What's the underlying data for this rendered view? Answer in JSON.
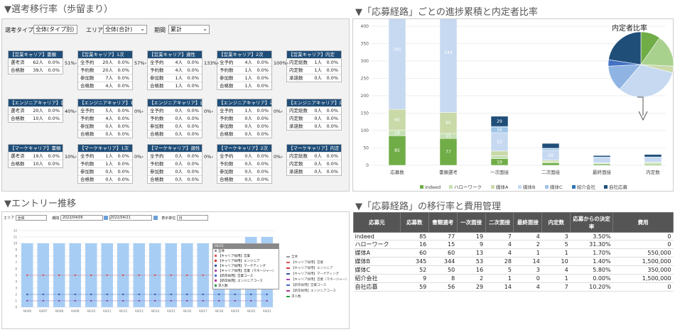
{
  "sections": {
    "funnel": "▼選考移行率（歩留まり）",
    "stack": "▼「応募経路」ごとの進捗累積と内定者比率",
    "entry": "▼エントリー推移",
    "cost": "▼「応募経路」の移行率と費用管理"
  },
  "filters": {
    "type_label": "選考タイプ",
    "type_value": "全体(タイプ別)",
    "area_label": "エリア",
    "area_value": "全体(合計)",
    "period_label": "期間",
    "period_value": "累計"
  },
  "funnel": {
    "rows": [
      {
        "cards": [
          {
            "title": "【営業キャリア】書類",
            "items": [
              {
                "l": "選考済",
                "v": "62",
                "u": "人",
                "p": "0.0%"
              },
              {
                "l": "合格数",
                "v": "39",
                "u": "人",
                "p": "0.0%"
              }
            ]
          },
          {
            "title": "【営業キャリア】1次",
            "items": [
              {
                "l": "全予約",
                "v": "20",
                "u": "人",
                "p": "0.0%"
              },
              {
                "l": "予約数",
                "v": "20",
                "u": "人",
                "p": "0.0%"
              },
              {
                "l": "参加数",
                "v": "7",
                "u": "人",
                "p": "0.0%"
              },
              {
                "l": "合格数",
                "v": "4",
                "u": "人",
                "p": "0.0%"
              }
            ]
          },
          {
            "title": "【営業キャリア】適性",
            "items": [
              {
                "l": "全予約",
                "v": "4",
                "u": "人",
                "p": "0.0%"
              },
              {
                "l": "予約数",
                "v": "4",
                "u": "人",
                "p": "0.0%"
              },
              {
                "l": "参加数",
                "v": "1",
                "u": "人",
                "p": "0.0%"
              },
              {
                "l": "合格数",
                "v": "1",
                "u": "人",
                "p": "0.0%"
              }
            ]
          },
          {
            "title": "【営業キャリア】2次",
            "items": [
              {
                "l": "全予約",
                "v": "4",
                "u": "人",
                "p": "0.0%"
              },
              {
                "l": "予約数",
                "v": "1",
                "u": "人",
                "p": "0.0%"
              },
              {
                "l": "参加数",
                "v": "1",
                "u": "人",
                "p": "0.0%"
              },
              {
                "l": "合格数",
                "v": "1",
                "u": "人",
                "p": "0.0%"
              }
            ]
          },
          {
            "title": "【営業キャリア】内定",
            "items": [
              {
                "l": "内定総数",
                "v": "1",
                "u": "人",
                "p": "0.0%"
              },
              {
                "l": "内定数",
                "v": "1",
                "u": "人",
                "p": "0.0%"
              },
              {
                "l": "承諾数",
                "v": "0",
                "u": "人",
                "p": "0.0%"
              }
            ]
          }
        ],
        "rates": [
          "51%",
          "57%",
          "133%",
          "100%"
        ]
      },
      {
        "cards": [
          {
            "title": "【エンジニアキャリア】書類",
            "items": [
              {
                "l": "選考済",
                "v": "20",
                "u": "人",
                "p": "0.0%"
              },
              {
                "l": "合格数",
                "v": "10",
                "u": "人",
                "p": "0.0%"
              }
            ]
          },
          {
            "title": "【エンジニアキャリア】1次",
            "items": [
              {
                "l": "全予約",
                "v": "5",
                "u": "人",
                "p": "0.0%"
              },
              {
                "l": "予約数",
                "v": "4",
                "u": "人",
                "p": "0.0%"
              },
              {
                "l": "参加数",
                "v": "0",
                "u": "人",
                "p": "0.0%"
              },
              {
                "l": "合格数",
                "v": "0",
                "u": "人",
                "p": "0.0%"
              }
            ]
          },
          {
            "title": "【エンジニアキャリア】適性",
            "items": [
              {
                "l": "全予約",
                "v": "0",
                "u": "人",
                "p": "0.0%"
              },
              {
                "l": "予約数",
                "v": "0",
                "u": "人",
                "p": "0.0%"
              },
              {
                "l": "参加数",
                "v": "0",
                "u": "人",
                "p": "0.0%"
              },
              {
                "l": "合格数",
                "v": "0",
                "u": "人",
                "p": "0.0%"
              }
            ]
          },
          {
            "title": "【エンジニアキャリア】2次",
            "items": [
              {
                "l": "全予約",
                "v": "1",
                "u": "人",
                "p": "0.0%"
              },
              {
                "l": "予約数",
                "v": "0",
                "u": "人",
                "p": "0.0%"
              },
              {
                "l": "参加数",
                "v": "0",
                "u": "人",
                "p": "0.0%"
              },
              {
                "l": "合格数",
                "v": "0",
                "u": "人",
                "p": "0.0%"
              }
            ]
          },
          {
            "title": "【エンジニアキャリア】内定",
            "items": [
              {
                "l": "内定総数",
                "v": "0",
                "u": "人",
                "p": "0.0%"
              },
              {
                "l": "内定数",
                "v": "0",
                "u": "人",
                "p": "0.0%"
              },
              {
                "l": "承諾数",
                "v": "0",
                "u": "人",
                "p": "0.0%"
              }
            ]
          }
        ],
        "rates": [
          "40%",
          "0%",
          "0%",
          "0%"
        ]
      },
      {
        "cards": [
          {
            "title": "【マーケキャリア】書類",
            "items": [
              {
                "l": "選考済",
                "v": "19",
                "u": "人",
                "p": "0.0%"
              },
              {
                "l": "合格数",
                "v": "10",
                "u": "人",
                "p": "0.0%"
              }
            ]
          },
          {
            "title": "【マーケキャリア】1次",
            "items": [
              {
                "l": "全予約",
                "v": "1",
                "u": "人",
                "p": "0.0%"
              },
              {
                "l": "予約数",
                "v": "1",
                "u": "人",
                "p": "0.0%"
              },
              {
                "l": "参加数",
                "v": "0",
                "u": "人",
                "p": "0.0%"
              },
              {
                "l": "合格数",
                "v": "0",
                "u": "人",
                "p": "0.0%"
              }
            ]
          },
          {
            "title": "【マーケキャリア】適性",
            "items": [
              {
                "l": "全予約",
                "v": "0",
                "u": "人",
                "p": "0.0%"
              },
              {
                "l": "予約数",
                "v": "0",
                "u": "人",
                "p": "0.0%"
              },
              {
                "l": "参加数",
                "v": "0",
                "u": "人",
                "p": "0.0%"
              },
              {
                "l": "合格数",
                "v": "0",
                "u": "人",
                "p": "0.0%"
              }
            ]
          },
          {
            "title": "【マーケキャリア】2次",
            "items": [
              {
                "l": "全予約",
                "v": "0",
                "u": "人",
                "p": "0.0%"
              },
              {
                "l": "予約数",
                "v": "0",
                "u": "人",
                "p": "0.0%"
              },
              {
                "l": "参加数",
                "v": "0",
                "u": "人",
                "p": "0.0%"
              },
              {
                "l": "合格数",
                "v": "0",
                "u": "人",
                "p": "0.0%"
              }
            ]
          },
          {
            "title": "【マーケキャリア】内定",
            "items": [
              {
                "l": "内定総数",
                "v": "0",
                "u": "人",
                "p": "0.0%"
              },
              {
                "l": "内定数",
                "v": "0",
                "u": "人",
                "p": "0.0%"
              },
              {
                "l": "承諾数",
                "v": "0",
                "u": "人",
                "p": "0.0%"
              }
            ]
          }
        ],
        "rates": [
          "10%",
          "0%",
          "0%",
          "0%"
        ]
      }
    ]
  },
  "cost_table": {
    "headers": [
      "応募元",
      "応募数",
      "書類選考",
      "一次面接",
      "二次面接",
      "最終面接",
      "内定数",
      "応募からの決定率",
      "費用"
    ],
    "rows": [
      [
        "indeed",
        "85",
        "77",
        "19",
        "7",
        "4",
        "3",
        "3.50%",
        "0"
      ],
      [
        "ハローワーク",
        "16",
        "15",
        "9",
        "4",
        "2",
        "5",
        "31.30%",
        "0"
      ],
      [
        "媒体A",
        "60",
        "60",
        "13",
        "4",
        "1",
        "1",
        "1.70%",
        "550,000"
      ],
      [
        "媒体B",
        "345",
        "344",
        "53",
        "28",
        "14",
        "10",
        "1.40%",
        "1,500,000"
      ],
      [
        "媒体C",
        "52",
        "50",
        "16",
        "5",
        "3",
        "4",
        "5.80%",
        "350,000"
      ],
      [
        "紹介会社",
        "9",
        "8",
        "2",
        "1",
        "0",
        "1",
        "0.00%",
        "1,500,000"
      ],
      [
        "自社応募",
        "59",
        "56",
        "29",
        "14",
        "4",
        "7",
        "10.20%",
        "0"
      ]
    ]
  },
  "entry_filters": {
    "area_label": "エリア",
    "area_value": "全体",
    "period_label": "期間",
    "date_from": "2022/04/06",
    "date_to": "2022/04/21",
    "unit_label": "表示単位",
    "unit_value": "日"
  },
  "entry_tooltip": {
    "header": "04/21",
    "rows": [
      "全体",
      "【キャリア採用】営業",
      "【キャリア採用】エンジニア",
      "【キャリア採用】マーケティング",
      "【キャリア採用】営業（マネージャー）",
      "【新卒採用】営業コース",
      "【新卒採用】エンジニアコース",
      "求人数"
    ]
  },
  "entry_legend": [
    "全体",
    "【キャリア採用】営業",
    "【キャリア採用】エンジニア",
    "【キャリア採用】マーケティング",
    "【キャリア採用】営業（マネージャー）",
    "【新卒採用】営業コース",
    "【新卒採用】エンジニアコース",
    "求人数"
  ],
  "chart_data": [
    {
      "type": "bar",
      "stacked": true,
      "categories": [
        "応募数",
        "書類選考",
        "一次面接",
        "二次面接",
        "最終面接",
        "内定数"
      ],
      "series": [
        {
          "name": "indeed",
          "values": [
            85,
            77,
            19,
            7,
            4,
            3
          ]
        },
        {
          "name": "ハローワーク",
          "values": [
            16,
            15,
            9,
            4,
            2,
            5
          ]
        },
        {
          "name": "媒体A",
          "values": [
            60,
            60,
            13,
            4,
            1,
            1
          ]
        },
        {
          "name": "媒体B",
          "values": [
            345,
            344,
            53,
            28,
            14,
            10
          ]
        },
        {
          "name": "媒体C",
          "values": [
            52,
            50,
            16,
            5,
            3,
            4
          ]
        },
        {
          "name": "紹介会社",
          "values": [
            9,
            8,
            2,
            1,
            0,
            1
          ]
        },
        {
          "name": "自社応募",
          "values": [
            59,
            56,
            29,
            14,
            4,
            7
          ]
        }
      ],
      "ylim": [
        0,
        400
      ],
      "yticks": [
        0,
        50,
        100,
        150,
        200,
        250,
        300,
        350,
        400
      ],
      "colors": [
        "#70ad47",
        "#c5e0b4",
        "#c9d9a8",
        "#c6d9f1",
        "#9dc3e6",
        "#2e75b6",
        "#1f4e79"
      ],
      "legend": "bottom"
    },
    {
      "type": "pie",
      "title": "内定者比率",
      "labels": [
        "indeed",
        "ハローワーク",
        "媒体A",
        "媒体B",
        "媒体C",
        "紹介会社",
        "自社応募"
      ],
      "values": [
        3,
        5,
        1,
        10,
        4,
        1,
        7
      ],
      "colors": [
        "#70ad47",
        "#a9d18e",
        "#c9d9a8",
        "#c6d9f1",
        "#8fb4e3",
        "#4472c4",
        "#1f4e79"
      ]
    },
    {
      "type": "bar",
      "categories": [
        "04/06",
        "04/07",
        "04/08",
        "04/09",
        "04/10",
        "04/11",
        "04/12",
        "04/13",
        "04/14",
        "04/15",
        "04/16",
        "04/17",
        "04/18",
        "04/19",
        "04/20",
        "04/21"
      ],
      "values": [
        10,
        10,
        10,
        10,
        10,
        10,
        10,
        10,
        10,
        10,
        10,
        10,
        10,
        10,
        11,
        11
      ],
      "lines": [
        {
          "values": [
            5,
            5,
            5,
            5,
            5,
            5,
            5,
            5,
            5,
            5,
            5,
            5,
            5,
            5,
            5,
            5
          ],
          "color": "#e05050"
        },
        {
          "values": [
            2,
            2,
            2,
            2,
            2,
            2,
            2,
            2,
            2,
            2,
            2,
            2,
            2,
            2,
            2,
            2
          ],
          "color": "#3355aa"
        },
        {
          "values": [
            1,
            1,
            1,
            1,
            1,
            1,
            1,
            1,
            1,
            1,
            1,
            1,
            1,
            1,
            1,
            1
          ],
          "color": "#8844aa"
        }
      ],
      "ylim": [
        0,
        12
      ],
      "yticks": [
        0,
        1,
        2,
        3,
        4,
        5,
        6,
        7,
        8,
        9,
        10,
        11,
        12
      ]
    }
  ]
}
